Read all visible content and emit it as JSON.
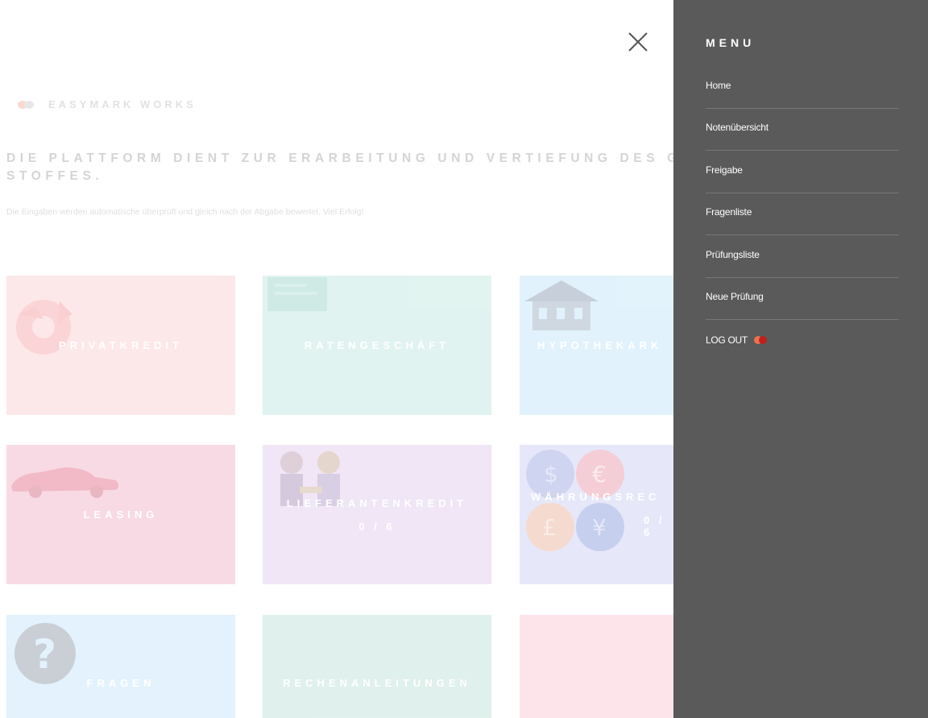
{
  "brand": {
    "name": "EASYMARK WORKS"
  },
  "headline": {
    "line1": "DIE PLATTFORM DIENT ZUR ERARBEITUNG UND VERTIEFUNG DES GELE",
    "line2": "STOFFES."
  },
  "subtext": "Die Eingaben werden automatische überprüft und gleich nach der Abgabe bewertet. Viel Erfolg!",
  "tiles": [
    {
      "label": "PRIVATKREDIT",
      "count": ""
    },
    {
      "label": "RATENGESCHÄFT",
      "count": ""
    },
    {
      "label": "HYPOTHEKARK",
      "count": ""
    },
    {
      "label": "LEASING",
      "count": ""
    },
    {
      "label": "LIEFERANTENKREDIT",
      "count": "0 / 6"
    },
    {
      "label": "WÄHRUNGSREC",
      "count": "0 / 6"
    },
    {
      "label": "FRAGEN",
      "count": ""
    },
    {
      "label": "RECHENANLEITUNGEN",
      "count": ""
    },
    {
      "label": "",
      "count": ""
    }
  ],
  "menu": {
    "title": "MENU",
    "items": [
      {
        "label": "Home"
      },
      {
        "label": "Notenübersicht"
      },
      {
        "label": "Freigabe"
      },
      {
        "label": "Fragenliste"
      },
      {
        "label": "Prüfungsliste"
      },
      {
        "label": "Neue Prüfung"
      }
    ],
    "logout": "LOG OUT"
  },
  "icons": {
    "close": "close-icon",
    "brand_logo": "brand-logo-icon",
    "logout_logo": "logout-logo-icon"
  },
  "colors": {
    "menu_bg": "#5a5a5a",
    "menu_divider": "#787878",
    "tile_privatkredit": "#fbc9cd",
    "tile_ratengeschaeft": "#b9e4dc",
    "tile_hypothekar": "#b9e2f8",
    "tile_leasing": "#f0a8c0",
    "tile_lieferantenkredit": "#dcc4e9",
    "tile_waehrung": "#c4c9f2",
    "tile_fragen": "#bde1f8",
    "tile_rechenanleitungen": "#b7ddd2",
    "tile_blank": "#f8bfcc"
  }
}
